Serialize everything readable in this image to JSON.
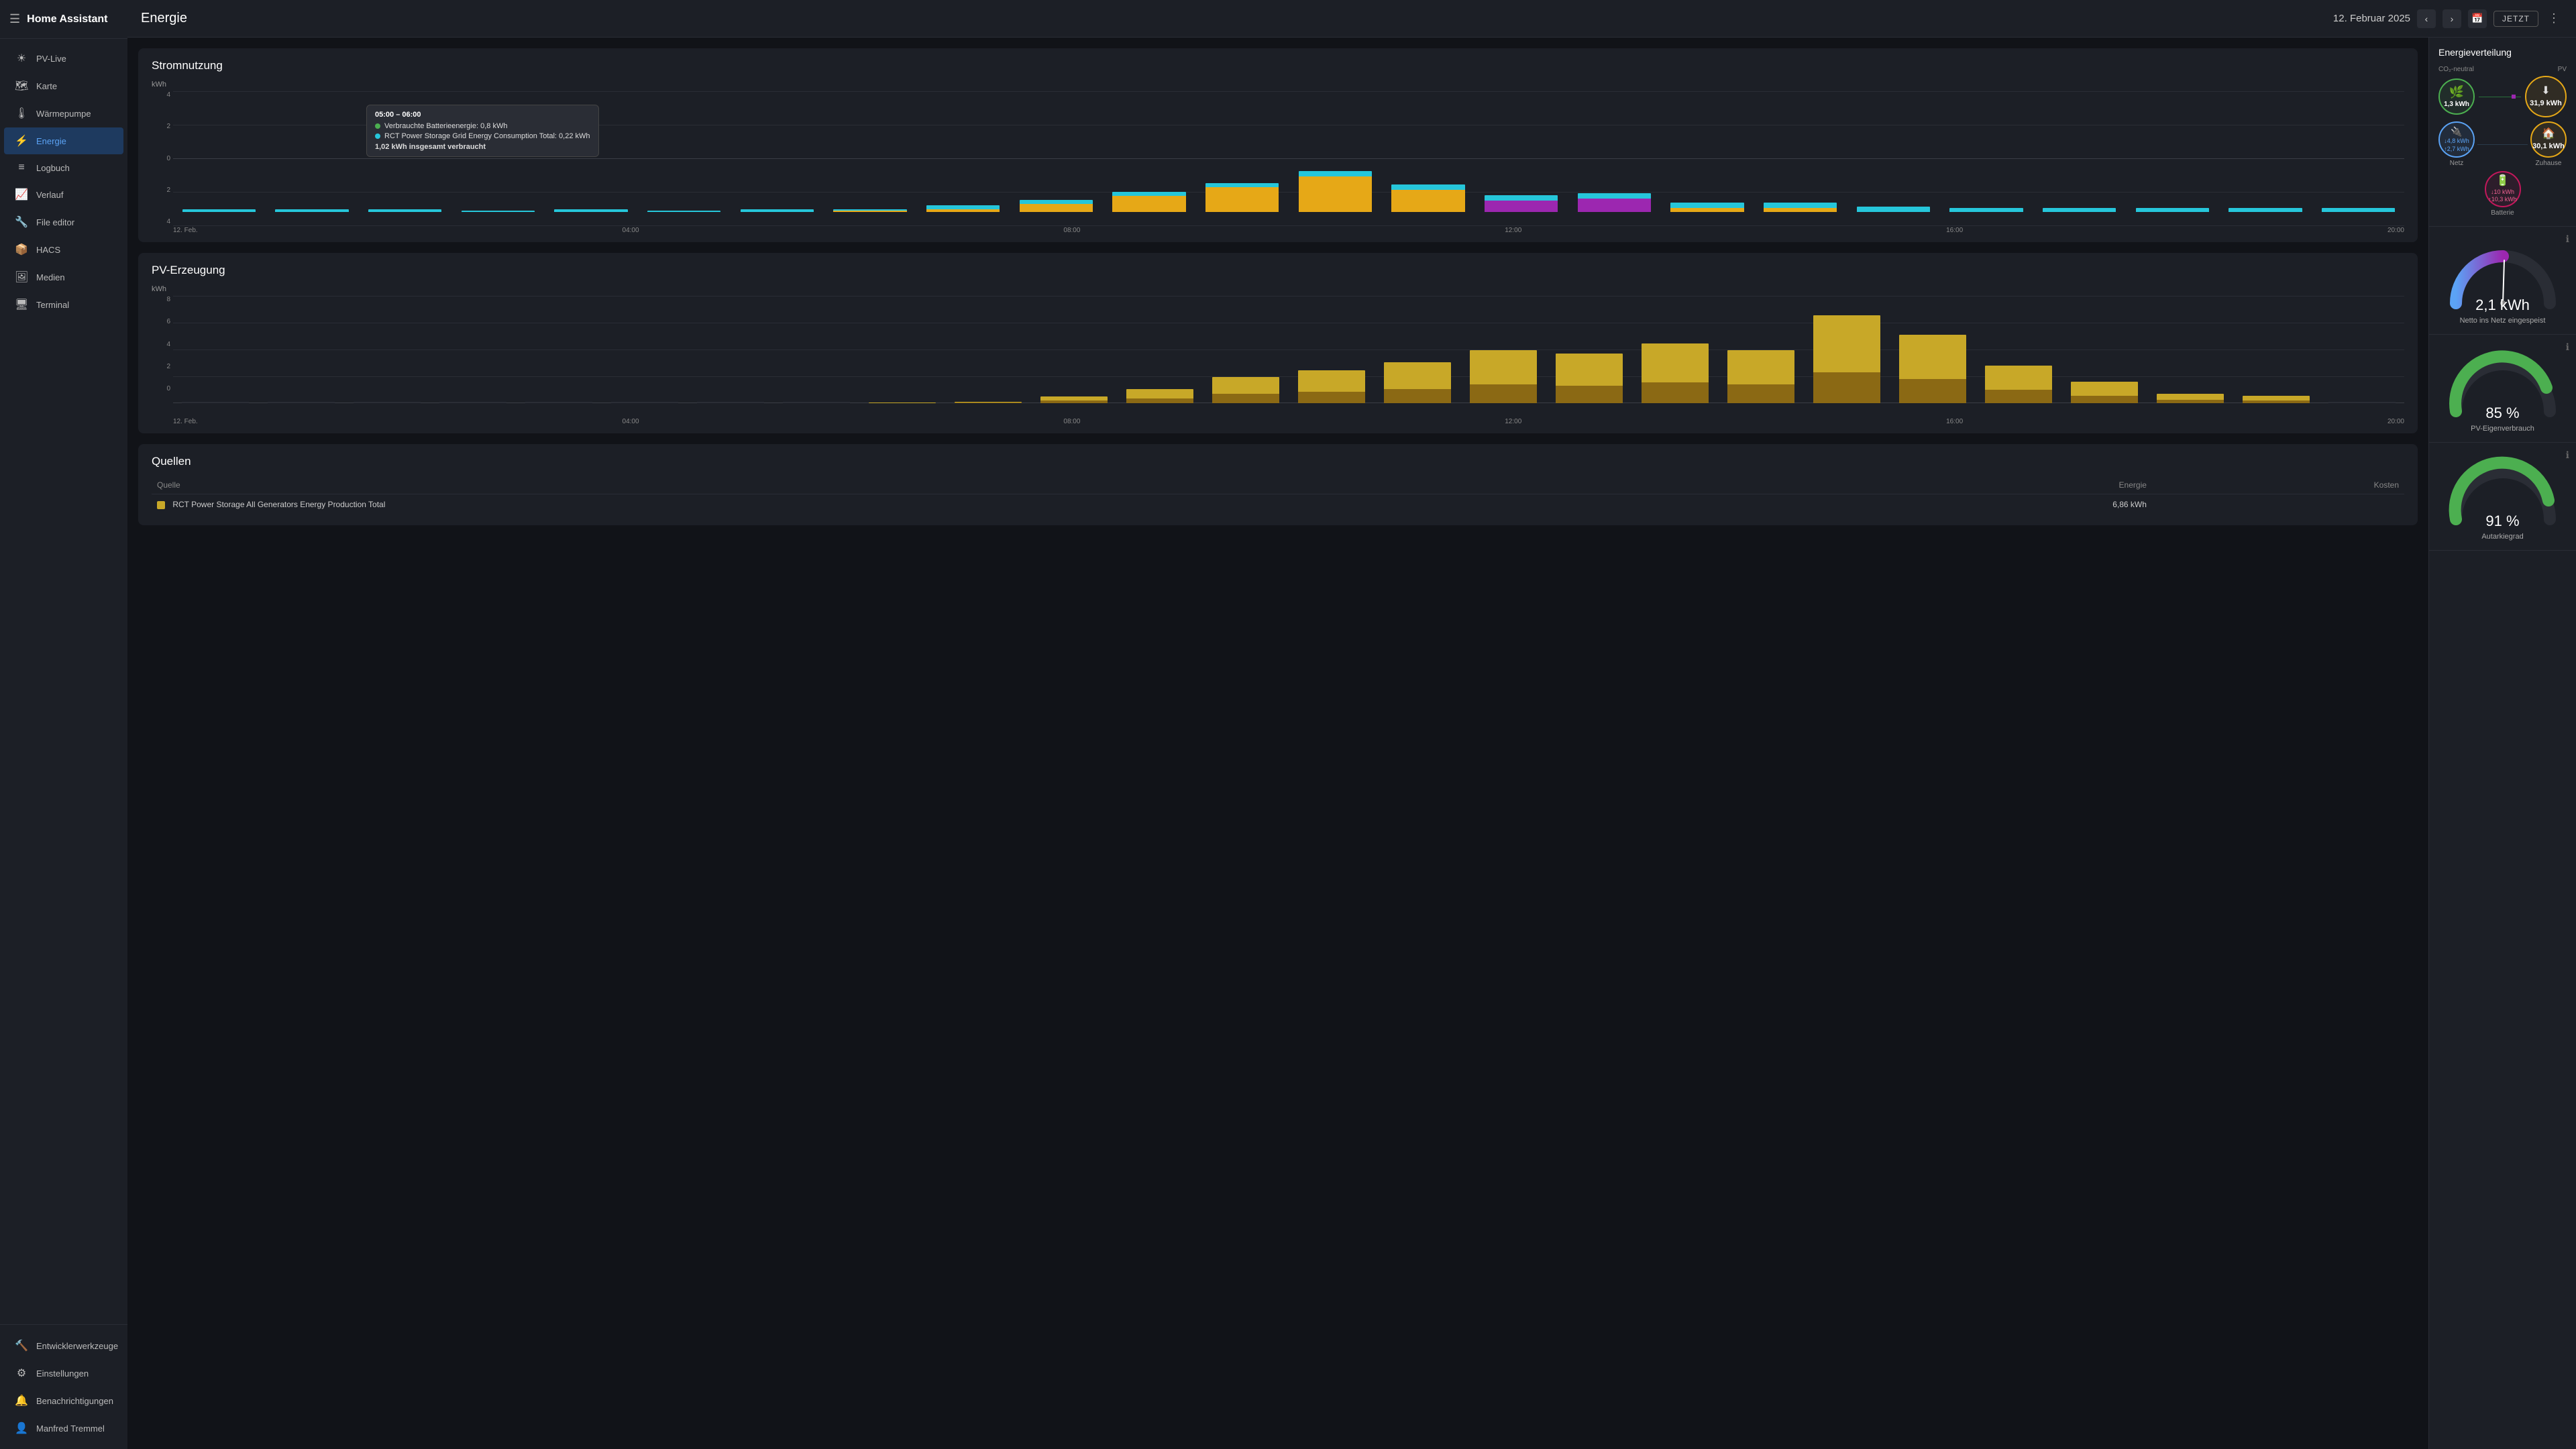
{
  "app": {
    "title": "Home Assistant",
    "page": "Energie"
  },
  "topbar": {
    "date": "12. Februar 2025",
    "jetzt_label": "JETZT"
  },
  "sidebar": {
    "items": [
      {
        "label": "PV-Live",
        "icon": "☀",
        "active": false
      },
      {
        "label": "Karte",
        "icon": "🗺",
        "active": false
      },
      {
        "label": "Wärmepumpe",
        "icon": "🌡",
        "active": false
      },
      {
        "label": "Energie",
        "icon": "⚡",
        "active": true
      },
      {
        "label": "Logbuch",
        "icon": "≡",
        "active": false
      },
      {
        "label": "Verlauf",
        "icon": "📈",
        "active": false
      },
      {
        "label": "File editor",
        "icon": "🔧",
        "active": false
      },
      {
        "label": "HACS",
        "icon": "📦",
        "active": false
      },
      {
        "label": "Medien",
        "icon": "🖼",
        "active": false
      },
      {
        "label": "Terminal",
        "icon": "🖥",
        "active": false
      }
    ],
    "footer": [
      {
        "label": "Entwicklerwerkzeuge",
        "icon": "🔨"
      },
      {
        "label": "Einstellungen",
        "icon": "⚙"
      },
      {
        "label": "Benachrichtigungen",
        "icon": "🔔"
      },
      {
        "label": "Manfred Tremmel",
        "icon": "👤"
      }
    ]
  },
  "stromnutzung": {
    "title": "Stromnutzung",
    "unit": "kWh",
    "y_max": 4,
    "y_min": -4,
    "tooltip": {
      "time": "05:00 – 06:00",
      "rows": [
        {
          "label": "Verbrauchte Batterieenergie: 0,8 kWh",
          "color": "#4caf50"
        },
        {
          "label": "RCT Power Storage Grid Energy Consumption Total: 0,22 kWh",
          "color": "#26c6da"
        }
      ],
      "total": "1,02 kWh insgesamt verbraucht"
    },
    "x_labels": [
      "12. Feb.",
      "04:00",
      "08:00",
      "12:00",
      "16:00",
      "20:00"
    ],
    "bars": [
      {
        "teal": 0.18,
        "orange": 0,
        "purple": 0
      },
      {
        "teal": 0.22,
        "orange": 0,
        "purple": 0
      },
      {
        "teal": 0.18,
        "orange": 0,
        "purple": 0
      },
      {
        "teal": 0.08,
        "orange": 0,
        "purple": 0
      },
      {
        "teal": 0.18,
        "orange": 0,
        "purple": 0
      },
      {
        "teal": 0.1,
        "orange": 0,
        "purple": 0
      },
      {
        "teal": 0.22,
        "orange": 0,
        "purple": 0
      },
      {
        "teal": 0.1,
        "orange": 0.12,
        "purple": 0
      },
      {
        "teal": 0.28,
        "orange": 0.22,
        "purple": 0
      },
      {
        "teal": 0.3,
        "orange": 0.6,
        "purple": 0
      },
      {
        "teal": 0.28,
        "orange": 1.2,
        "purple": 0
      },
      {
        "teal": 0.28,
        "orange": 1.85,
        "purple": 0
      },
      {
        "teal": 0.38,
        "orange": 2.65,
        "purple": 0
      },
      {
        "teal": 0.42,
        "orange": 1.65,
        "purple": 0
      },
      {
        "teal": 0.42,
        "orange": 0.0,
        "purple": 0.85
      },
      {
        "teal": 0.38,
        "orange": 0.0,
        "purple": 1.0
      },
      {
        "teal": 0.38,
        "orange": 0.3,
        "purple": 0
      },
      {
        "teal": 0.38,
        "orange": 0.28,
        "purple": 0
      },
      {
        "teal": 0.38,
        "orange": 0,
        "purple": 0
      },
      {
        "teal": 0.28,
        "orange": 0,
        "purple": 0
      },
      {
        "teal": 0.28,
        "orange": 0,
        "purple": 0
      },
      {
        "teal": 0.28,
        "orange": 0,
        "purple": 0
      },
      {
        "teal": 0.3,
        "orange": 0,
        "purple": 0
      },
      {
        "teal": 0.28,
        "orange": 0,
        "purple": 0
      }
    ]
  },
  "pv_erzeugung": {
    "title": "PV-Erzeugung",
    "unit": "kWh",
    "y_max": 8,
    "x_labels": [
      "12. Feb.",
      "04:00",
      "08:00",
      "12:00",
      "16:00",
      "20:00"
    ],
    "bars": [
      0,
      0,
      0,
      0,
      0,
      0,
      0,
      0,
      0.05,
      0.12,
      0.55,
      1.2,
      2.2,
      2.8,
      3.5,
      4.5,
      4.2,
      5.1,
      4.5,
      7.5,
      5.8,
      3.2,
      1.8,
      0.8,
      0.6,
      0
    ]
  },
  "energy_dist": {
    "title": "Energieverteilung",
    "nodes": {
      "co2neutral": {
        "label": "CO₂-neutral",
        "value": "1,3 kWh",
        "color": "#4caf50"
      },
      "pv": {
        "label": "PV",
        "value": "31,9 kWh",
        "color": "#e6a817"
      },
      "netz": {
        "label": "Netz",
        "value1": "↓4,8 kWh",
        "value2": "↑2,7 kWh",
        "color": "#5ba3f5"
      },
      "zuhause": {
        "label": "Zuhause",
        "value": "30,1 kWh",
        "color": "#e6a817"
      },
      "batterie": {
        "label": "Batterie",
        "value1": "↓10 kWh",
        "value2": "↑10,3 kWh",
        "color": "#c2185b"
      }
    }
  },
  "gauges": [
    {
      "value": "2,1 kWh",
      "label": "Netto ins Netz eingespeist",
      "percent": 28,
      "color_start": "#5ba3f5",
      "color_end": "#9c27b0"
    },
    {
      "value": "85 %",
      "label": "PV-Eigenverbrauch",
      "percent": 85,
      "color": "#4caf50"
    },
    {
      "value": "91 %",
      "label": "Autarkiegrad",
      "percent": 91,
      "color": "#4caf50"
    }
  ],
  "quellen": {
    "title": "Quellen",
    "headers": [
      "Quelle",
      "Energie",
      "Kosten"
    ],
    "rows": [
      {
        "color": "#c8a828",
        "label": "RCT Power Storage All Generators Energy Production Total",
        "energie": "6,86 kWh",
        "kosten": ""
      }
    ]
  },
  "colors": {
    "teal": "#26c6da",
    "orange": "#e6a817",
    "purple": "#9c27b0",
    "green": "#4caf50",
    "blue": "#5ba3f5",
    "dark_bg": "#111318",
    "card_bg": "#1c1f26"
  }
}
